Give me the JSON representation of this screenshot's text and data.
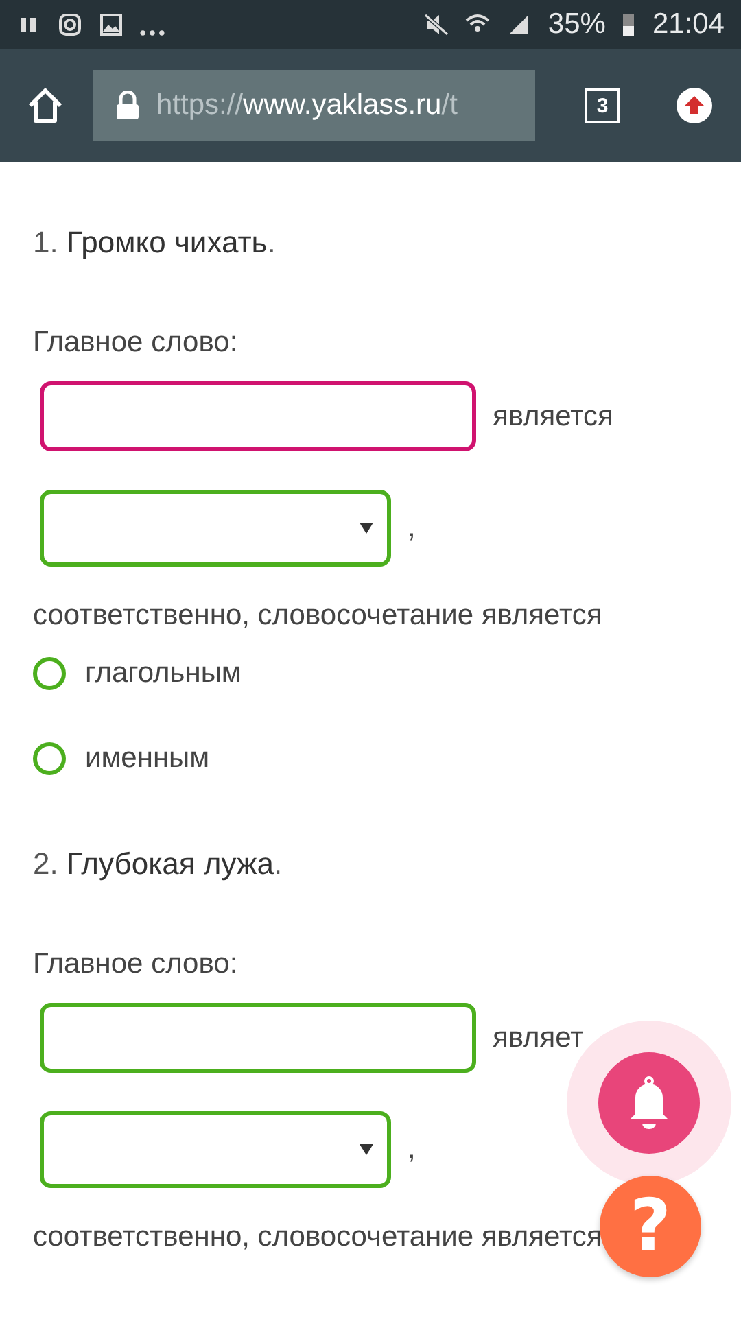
{
  "status_bar": {
    "battery": "35%",
    "time": "21:04"
  },
  "browser": {
    "url_scheme": "https://",
    "url_host": "www.yaklass.ru",
    "url_rest": "/t",
    "tab_count": "3"
  },
  "questions": [
    {
      "title": "1. **Громко чихать**.",
      "label": "Главное слово:",
      "field": {
        "color": "#d0136f"
      },
      "after_field": "является",
      "select": {
        "color": "#4caf1e"
      },
      "after_select": ",",
      "sentence": "соответственно, словосочетание является",
      "options": [
        {
          "label": "глагольным",
          "selected": false
        },
        {
          "label": "именным",
          "selected": false
        }
      ]
    },
    {
      "title": "2. **Глубокая лужа**.",
      "label": "Главное слово:",
      "field": {
        "color": "#4caf1e"
      },
      "after_field": "являет",
      "select": {
        "color": "#4caf1e"
      },
      "after_select": ",",
      "sentence": "соответственно, словосочетание является"
    }
  ],
  "help_button": {
    "label": "?"
  }
}
